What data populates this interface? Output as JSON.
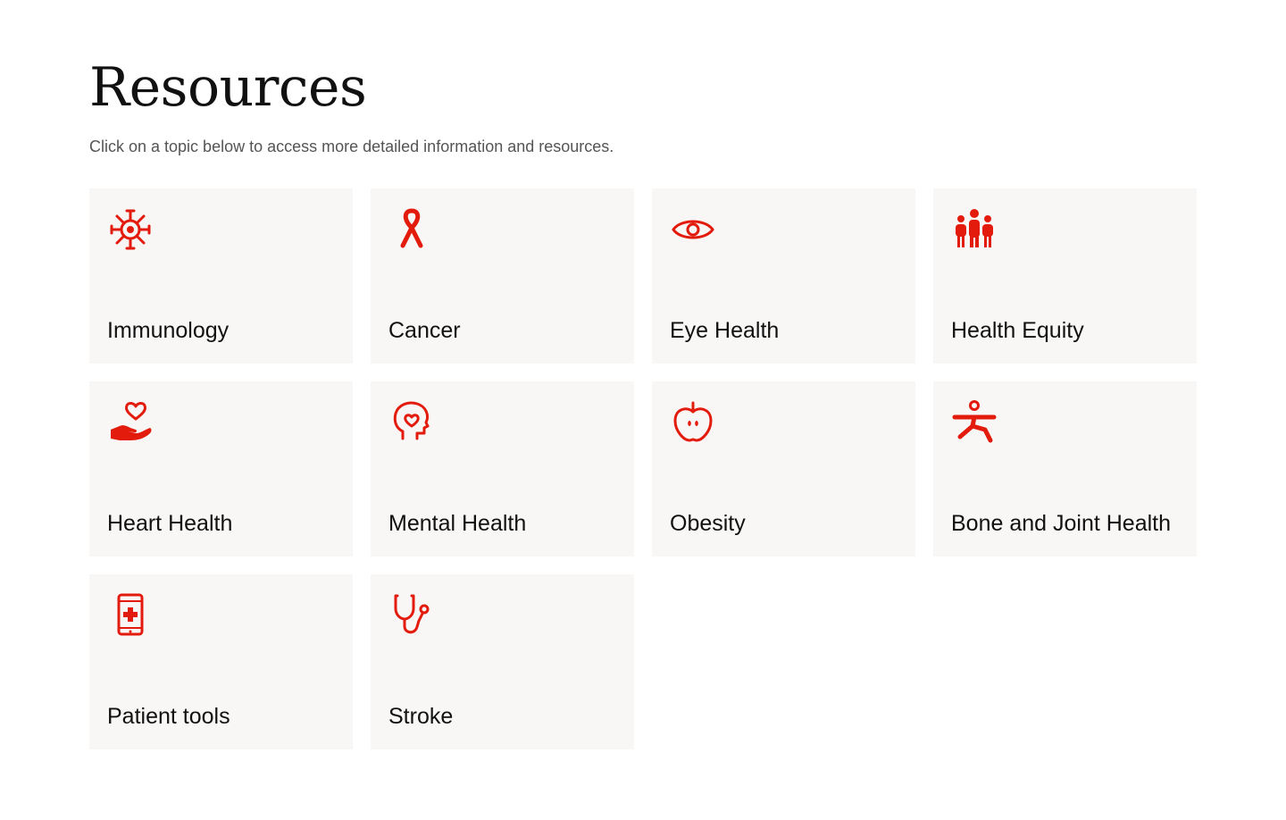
{
  "page": {
    "title": "Resources",
    "subtitle": "Click on a topic below to access more detailed information and resources."
  },
  "accent_color": "#e31b0c",
  "card_background": "#f8f7f6",
  "cards": [
    {
      "label": "Immunology",
      "icon": "virus-icon"
    },
    {
      "label": "Cancer",
      "icon": "ribbon-icon"
    },
    {
      "label": "Eye Health",
      "icon": "eye-icon"
    },
    {
      "label": "Health Equity",
      "icon": "people-icon"
    },
    {
      "label": "Heart Health",
      "icon": "heart-in-hand-icon"
    },
    {
      "label": "Mental Health",
      "icon": "head-heart-icon"
    },
    {
      "label": "Obesity",
      "icon": "apple-icon"
    },
    {
      "label": "Bone and Joint Health",
      "icon": "yoga-pose-icon"
    },
    {
      "label": "Patient tools",
      "icon": "mobile-medical-icon"
    },
    {
      "label": "Stroke",
      "icon": "stethoscope-icon"
    }
  ]
}
